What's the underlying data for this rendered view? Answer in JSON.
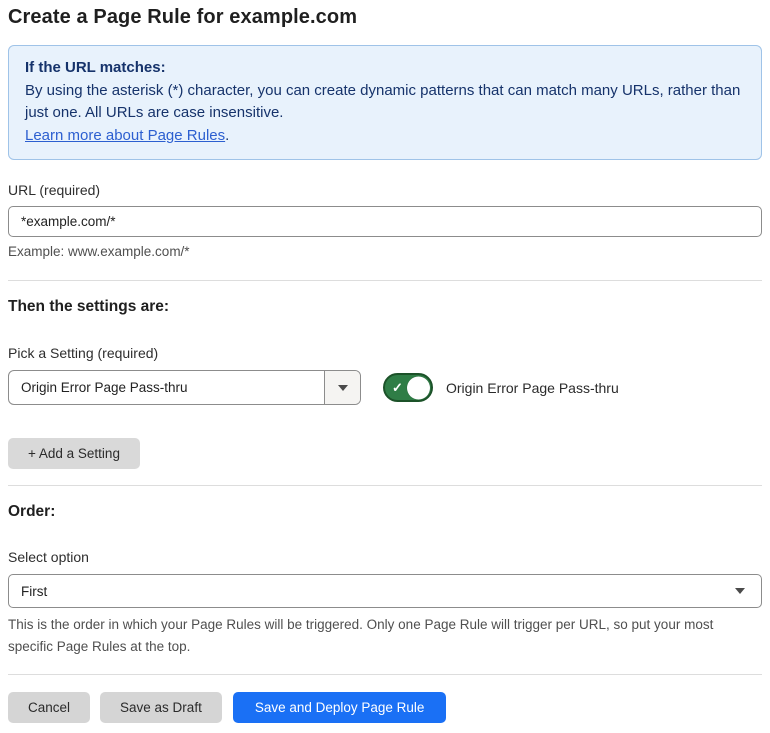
{
  "page": {
    "title": "Create a Page Rule for example.com"
  },
  "info_box": {
    "heading": "If the URL matches:",
    "body": "By using the asterisk (*) character, you can create dynamic patterns that can match many URLs, rather than just one. All URLs are case insensitive.",
    "link_label": "Learn more about Page Rules",
    "link_suffix": "."
  },
  "url_field": {
    "label": "URL (required)",
    "value": "*example.com/*",
    "helper": "Example: www.example.com/*"
  },
  "settings_section": {
    "heading": "Then the settings are:",
    "pick_label": "Pick a Setting (required)",
    "selected_setting": "Origin Error Page Pass-thru",
    "toggle_label": "Origin Error Page Pass-thru",
    "toggle_state": "on",
    "check_glyph": "✓",
    "add_setting_label": "+ Add a Setting"
  },
  "order_section": {
    "heading": "Order:",
    "select_label": "Select option",
    "selected_option": "First",
    "helper": "This is the order in which your Page Rules will be triggered. Only one Page Rule will trigger per URL, so put your most specific Page Rules at the top."
  },
  "footer": {
    "cancel_label": "Cancel",
    "save_draft_label": "Save as Draft",
    "save_deploy_label": "Save and Deploy Page Rule"
  },
  "colors": {
    "info_bg": "#e8f2fc",
    "info_border": "#9fc3e8",
    "info_text": "#16336b",
    "link_blue": "#2c5fd0",
    "toggle_green": "#2f7d46",
    "toggle_green_border": "#1c5229",
    "primary_blue": "#1a70f5",
    "button_gray": "#d5d5d5"
  }
}
